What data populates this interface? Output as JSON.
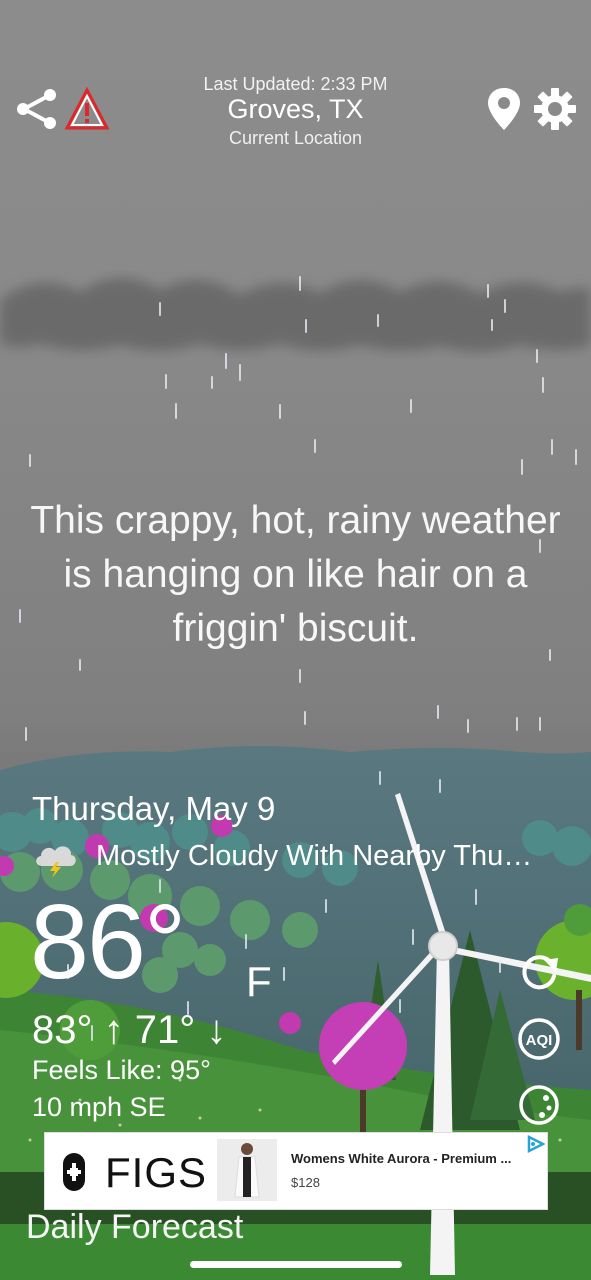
{
  "header": {
    "last_updated": "Last Updated: 2:33 PM",
    "city": "Groves, TX",
    "location_sub": "Current Location",
    "icons": [
      "share-icon",
      "alert-triangle-icon",
      "location-pin-icon",
      "gear-icon"
    ]
  },
  "snark": "This crappy, hot, rainy weather is hanging on like hair on a friggin' biscuit.",
  "current": {
    "day": "Thursday, May 9",
    "condition": "Mostly Cloudy With Nearby Thu…",
    "condition_icon": "thunderstorm-cloud-icon",
    "temp": "86°",
    "unit": "F",
    "hi_lo": "83° ↑ 71° ↓",
    "feels_like": "Feels Like: 95°",
    "wind": "10 mph SE"
  },
  "side_buttons": [
    "refresh-icon",
    "aqi-icon",
    "moon-phase-icon"
  ],
  "aqi_label": "AQI",
  "ad": {
    "brand": "FIGS",
    "title": "Womens White Aurora - Premium ...",
    "price": "$128"
  },
  "daily_forecast_title": "Daily Forecast",
  "colors": {
    "sky": "#8a8a8a",
    "hills_far": "#4f6d73",
    "grass": "#3f8a34",
    "tree_pink": "#c43fb5",
    "alert_red": "#e0262b"
  }
}
